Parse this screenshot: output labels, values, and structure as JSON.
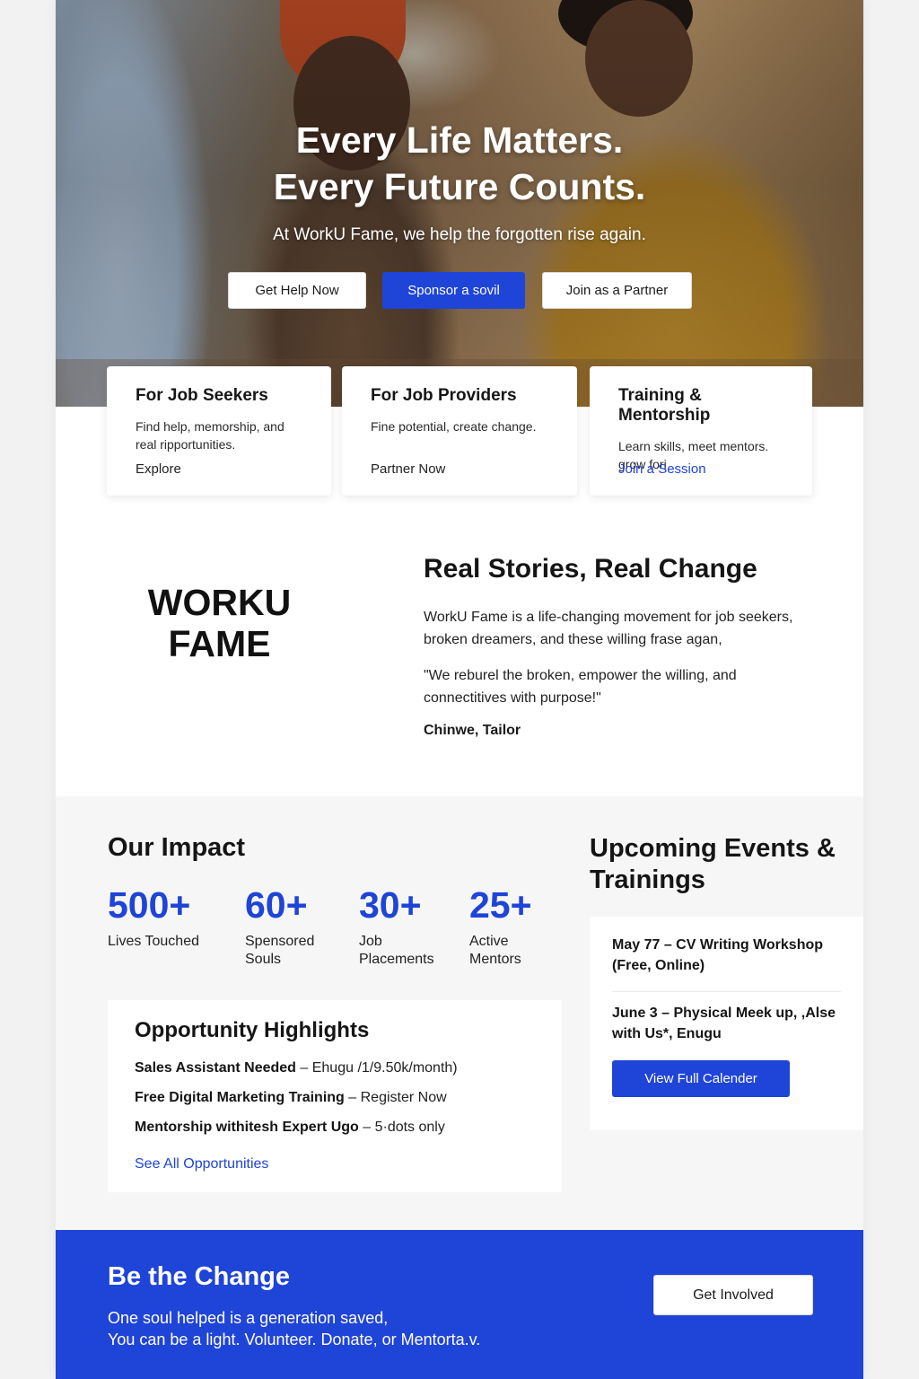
{
  "hero": {
    "title_line1": "Every Life Matters.",
    "title_line2": "Every Future Counts.",
    "subtitle": "At WorkU Fame, we help the forgotten rise again.",
    "buttons": {
      "get_help": "Get Help Now",
      "sponsor": "Sponsor a sovil",
      "partner": "Join as a Partner"
    }
  },
  "cards": [
    {
      "title": "For Job Seekers",
      "text": "Find help, memorship, and real ripportunities.",
      "link": "Explore"
    },
    {
      "title": "For Job Providers",
      "text": "Fine potential, create change.",
      "link": "Partner Now"
    },
    {
      "title": "Training & Mentorship",
      "text": "Learn skills, meet mentors. grow fori",
      "link": "Join a Session"
    }
  ],
  "logo": {
    "line1": "WORKU",
    "line2": "FAME"
  },
  "stories": {
    "title": "Real Stories, Real Change",
    "paragraph": "WorkU Fame is a life-changing movement for job seekers, broken dreamers, and these willing frase agan,",
    "quote": "\"We reburel the broken, empower the willing, and connectitives with purpose!\"",
    "author": "Chinwe, Tailor"
  },
  "impact": {
    "title": "Our Impact",
    "stats": [
      {
        "value": "500+",
        "label": "Lives Touched"
      },
      {
        "value": "60+",
        "label": "Spensored\nSouls"
      },
      {
        "value": "30+",
        "label": "Job\nPlacements"
      },
      {
        "value": "25+",
        "label": "Active\nMentors"
      }
    ]
  },
  "opportunities": {
    "title": "Opportunity Highlights",
    "items": [
      {
        "bold": "Sales Assistant Needed",
        "rest": " – Ehugu /1/9.50k/month)"
      },
      {
        "bold": "Free Digital Marketing Training",
        "rest": " – Register Now"
      },
      {
        "bold": "Mentorship withitesh Expert Ugo",
        "rest": " – 5·dots only"
      }
    ],
    "link": "See All Opportunities"
  },
  "events": {
    "title": "Upcoming Events & Trainings",
    "items": [
      "May 77 – CV Writing Workshop (Free, Online)",
      "June 3 – Physical Meek up, ,Alse with Us*, Enugu"
    ],
    "button": "View Full Calender"
  },
  "cta": {
    "title": "Be the Change",
    "line1": "One soul helped is a generation saved,",
    "line2": "You can be a light. Volunteer. Donate, or Mentorta.v.",
    "button": "Get Involved"
  },
  "colors": {
    "brand_blue": "#1f44d8",
    "text_dark": "#151515",
    "impact_bg": "#f6f6f6"
  }
}
